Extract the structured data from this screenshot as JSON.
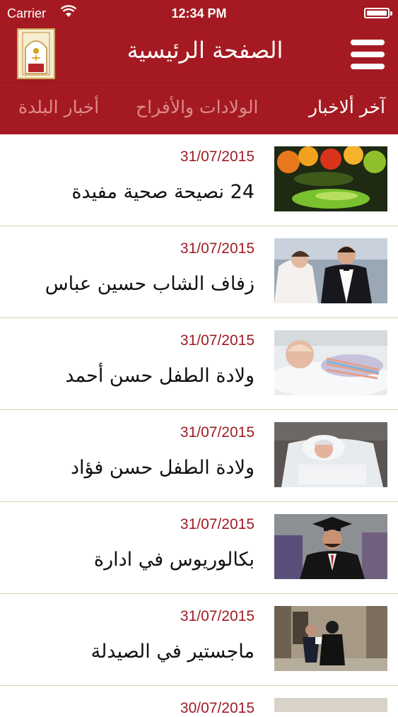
{
  "status_bar": {
    "carrier": "Carrier",
    "time": "12:34 PM"
  },
  "header": {
    "title": "الصفحة الرئيسية",
    "logo_icon": "town-logo-icon",
    "menu_icon": "hamburger-menu-icon"
  },
  "tabs": [
    {
      "label": "آخر ألاخبار",
      "active": true
    },
    {
      "label": "الولادات والأفراح",
      "active": false
    },
    {
      "label": "أخبار البلدة",
      "active": false
    }
  ],
  "news": [
    {
      "date": "31/07/2015",
      "title": "24 نصيحة صحية مفيدة",
      "thumb": "fruits-photo"
    },
    {
      "date": "31/07/2015",
      "title": "زفاف الشاب حسين عباس",
      "thumb": "wedding-couple-photo"
    },
    {
      "date": "31/07/2015",
      "title": "ولادة الطفل حسن أحمد",
      "thumb": "newborn-baby-photo"
    },
    {
      "date": "31/07/2015",
      "title": "ولادة الطفل حسن فؤاد",
      "thumb": "newborn-baby-photo"
    },
    {
      "date": "31/07/2015",
      "title": "بكالوريوس في ادارة",
      "thumb": "graduate-photo"
    },
    {
      "date": "31/07/2015",
      "title": "ماجستير في الصيدلة",
      "thumb": "graduation-couple-photo"
    }
  ],
  "next_item": {
    "date": "30/07/2015"
  },
  "colors": {
    "primary": "#a51a22",
    "date_text": "#9e1c25",
    "divider": "#c7dcb3",
    "inactive_tab": "#dc8a8c"
  }
}
